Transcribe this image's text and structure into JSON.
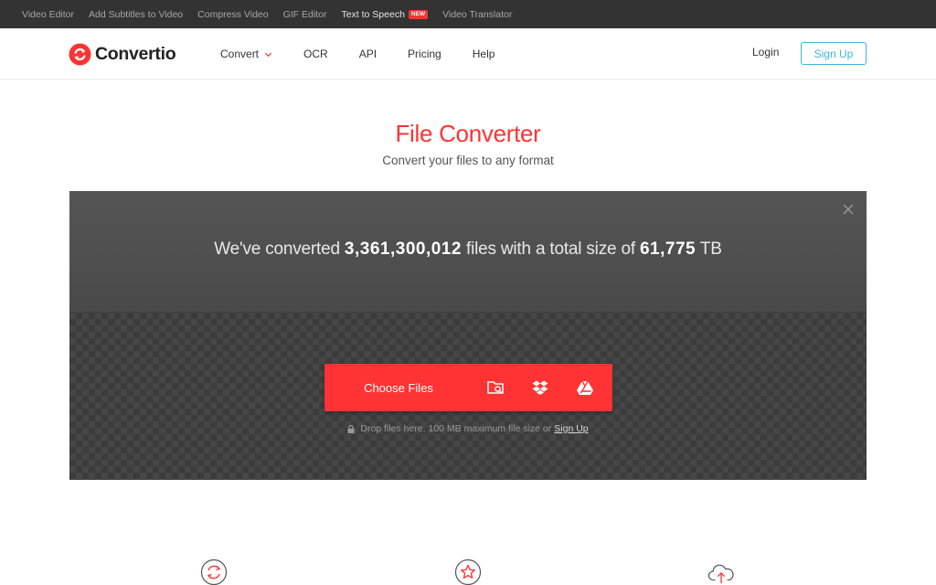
{
  "topbar": {
    "links": [
      {
        "label": "Video Editor"
      },
      {
        "label": "Add Subtitles to Video"
      },
      {
        "label": "Compress Video"
      },
      {
        "label": "GIF Editor"
      },
      {
        "label": "Text to Speech",
        "badge": "NEW"
      },
      {
        "label": "Video Translator"
      }
    ]
  },
  "header": {
    "brand": "Convertio",
    "nav": {
      "convert": "Convert",
      "ocr": "OCR",
      "api": "API",
      "pricing": "Pricing",
      "help": "Help"
    },
    "login": "Login",
    "signup": "Sign Up"
  },
  "hero": {
    "title": "File Converter",
    "subtitle": "Convert your files to any format"
  },
  "stats": {
    "prefix": "We've converted ",
    "files_count": "3,361,300,012",
    "middle": " files with a total size of ",
    "total_size": "61,775",
    "unit": " TB"
  },
  "uploader": {
    "choose_label": "Choose Files",
    "drop_note": "Drop files here. 100 MB maximum file size or",
    "signup_link": "Sign Up",
    "sources": [
      "folder-search-icon",
      "dropbox-icon",
      "google-drive-icon"
    ]
  },
  "colors": {
    "brand_red": "#ff3333",
    "accent_blue": "#3fb3d9",
    "topbar_bg": "#333333"
  },
  "features": {
    "icons": [
      "convert-cycle-icon",
      "star-icon",
      "cloud-upload-icon"
    ]
  }
}
